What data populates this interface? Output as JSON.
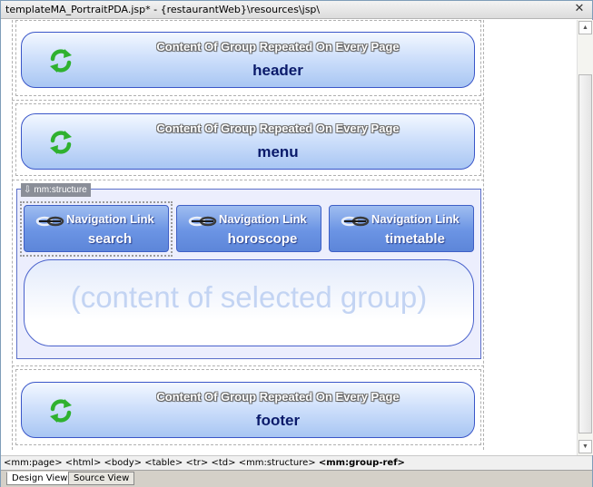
{
  "window": {
    "title": "templateMA_PortraitPDA.jsp* - {restaurantWeb}\\resources\\jsp\\",
    "close_glyph": "✕"
  },
  "groups": {
    "header": {
      "repeated": "Content Of Group Repeated On Every Page",
      "name": "header"
    },
    "menu": {
      "repeated": "Content Of Group Repeated On Every Page",
      "name": "menu"
    },
    "footer": {
      "repeated": "Content Of Group Repeated On Every Page",
      "name": "footer"
    }
  },
  "structure": {
    "tag": "mm:structure",
    "nav_links": [
      {
        "caption": "Navigation Link",
        "target": "search"
      },
      {
        "caption": "Navigation Link",
        "target": "horoscope"
      },
      {
        "caption": "Navigation Link",
        "target": "timetable"
      }
    ],
    "content_placeholder": "(content of selected group)"
  },
  "breadcrumb": [
    "<mm:page>",
    "<html>",
    "<body>",
    "<table>",
    "<tr>",
    "<td>",
    "<mm:structure>",
    "<mm:group-ref>"
  ],
  "tabs": {
    "design": "Design View",
    "source": "Source View"
  },
  "icons": {
    "group": "refresh-arrows-icon",
    "nav": "link-chain-icon",
    "struct": "down-arrow-icon"
  },
  "colors": {
    "group_border": "#3a56c8",
    "nav_fill": "#6b94e4",
    "refresh_green": "#2fb12f"
  }
}
